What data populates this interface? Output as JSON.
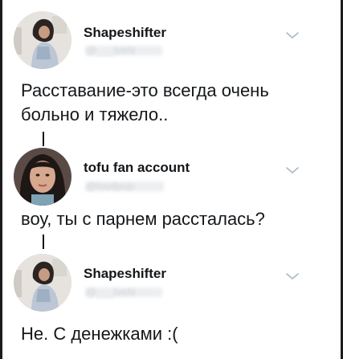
{
  "tweets": [
    {
      "name": "Shapeshifter",
      "handle": "@___lveN",
      "text_lines": [
        "Расставание-это всегда очень",
        "больно и тяжело.."
      ]
    },
    {
      "name": "tofu fan account",
      "handle": "@loudpup",
      "text_lines": [
        "воу, ты с парнем рассталась?"
      ]
    },
    {
      "name": "Shapeshifter",
      "handle": "@___lveN",
      "text_lines": [
        "Не. С денежками :("
      ]
    }
  ],
  "icons": {
    "avatar": "profile-photo",
    "menu": "chevron-down-icon"
  },
  "colors": {
    "text": "#14171a",
    "handle_blurred": "#d2d5d8",
    "chevron": "#aab8c2",
    "thread_line": "#111111"
  }
}
